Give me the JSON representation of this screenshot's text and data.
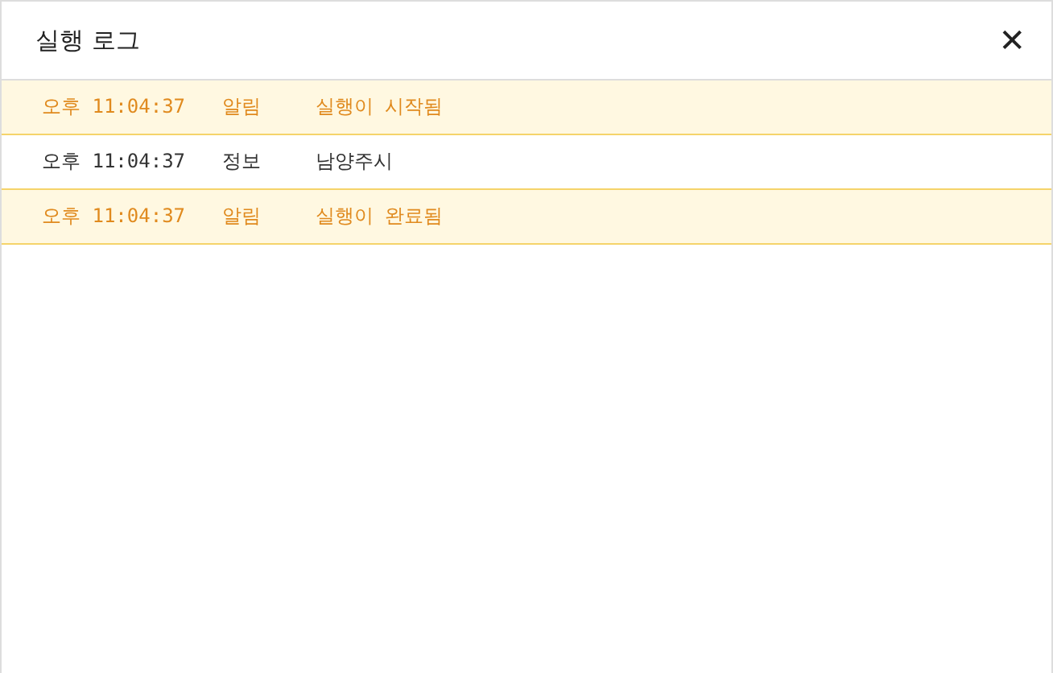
{
  "dialog": {
    "title": "실행 로그",
    "close": "✕"
  },
  "entries": [
    {
      "time": "오후 11:04:37",
      "level": "알림",
      "message": "실행이 시작됨",
      "kind": "alert"
    },
    {
      "time": "오후 11:04:37",
      "level": "정보",
      "message": "남양주시",
      "kind": "info"
    },
    {
      "time": "오후 11:04:37",
      "level": "알림",
      "message": "실행이 완료됨",
      "kind": "alert"
    }
  ]
}
